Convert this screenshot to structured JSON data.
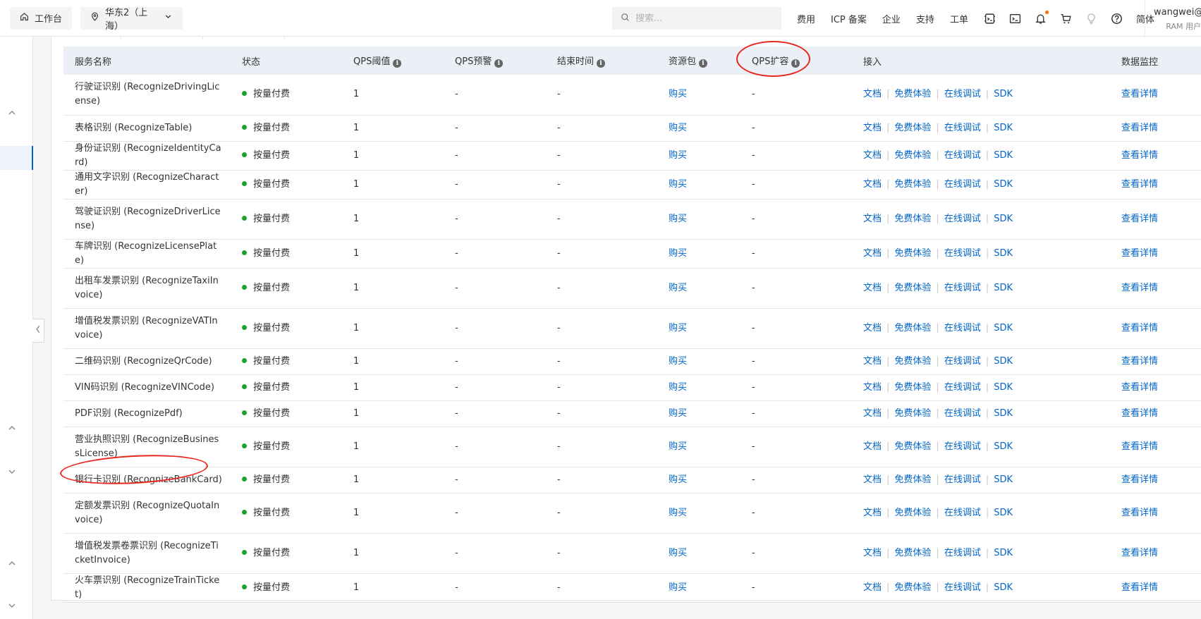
{
  "topbar": {
    "workbench_label": "工作台",
    "region_label": "华东2（上海）",
    "search_placeholder": "搜索...",
    "links": [
      "费用",
      "ICP 备案",
      "企业",
      "支持",
      "工单"
    ],
    "lang_label": "简体",
    "user_name": "wangwei@y...",
    "user_role": "RAM 用户"
  },
  "table": {
    "headers": {
      "service": "服务名称",
      "status": "状态",
      "qps_threshold": "QPS阈值",
      "qps_alert": "QPS预警",
      "end_time": "结束时间",
      "resource_pack": "资源包",
      "qps_scale": "QPS扩容",
      "access": "接入",
      "monitor": "数据监控"
    },
    "action_labels": {
      "buy": "购买",
      "docs": "文档",
      "trial": "免费体验",
      "debug": "在线调试",
      "sdk": "SDK",
      "details": "查看详情"
    },
    "rows": [
      {
        "service": "行驶证识别 (RecognizeDrivingLicense)",
        "status": "按量付费",
        "qps": "1",
        "alert": "-",
        "end": "-",
        "scale": "-"
      },
      {
        "service": "表格识别 (RecognizeTable)",
        "status": "按量付费",
        "qps": "1",
        "alert": "-",
        "end": "-",
        "scale": "-"
      },
      {
        "service": "身份证识别 (RecognizeIdentityCard)",
        "status": "按量付费",
        "qps": "1",
        "alert": "-",
        "end": "-",
        "scale": "-"
      },
      {
        "service": "通用文字识别 (RecognizeCharacter)",
        "status": "按量付费",
        "qps": "1",
        "alert": "-",
        "end": "-",
        "scale": "-"
      },
      {
        "service": "驾驶证识别 (RecognizeDriverLicense)",
        "status": "按量付费",
        "qps": "1",
        "alert": "-",
        "end": "-",
        "scale": "-"
      },
      {
        "service": "车牌识别 (RecognizeLicensePlate)",
        "status": "按量付费",
        "qps": "1",
        "alert": "-",
        "end": "-",
        "scale": "-"
      },
      {
        "service": "出租车发票识别 (RecognizeTaxiInvoice)",
        "status": "按量付费",
        "qps": "1",
        "alert": "-",
        "end": "-",
        "scale": "-"
      },
      {
        "service": "增值税发票识别 (RecognizeVATInvoice)",
        "status": "按量付费",
        "qps": "1",
        "alert": "-",
        "end": "-",
        "scale": "-"
      },
      {
        "service": "二维码识别 (RecognizeQrCode)",
        "status": "按量付费",
        "qps": "1",
        "alert": "-",
        "end": "-",
        "scale": "-"
      },
      {
        "service": "VIN码识别 (RecognizeVINCode)",
        "status": "按量付费",
        "qps": "1",
        "alert": "-",
        "end": "-",
        "scale": "-"
      },
      {
        "service": "PDF识别 (RecognizePdf)",
        "status": "按量付费",
        "qps": "1",
        "alert": "-",
        "end": "-",
        "scale": "-"
      },
      {
        "service": "营业执照识别 (RecognizeBusinessLicense)",
        "status": "按量付费",
        "qps": "1",
        "alert": "-",
        "end": "-",
        "scale": "-"
      },
      {
        "service": "银行卡识别 (RecognizeBankCard)",
        "status": "按量付费",
        "qps": "1",
        "alert": "-",
        "end": "-",
        "scale": "-"
      },
      {
        "service": "定额发票识别 (RecognizeQuotaInvoice)",
        "status": "按量付费",
        "qps": "1",
        "alert": "-",
        "end": "-",
        "scale": "-"
      },
      {
        "service": "增值税发票卷票识别 (RecognizeTicketInvoice)",
        "status": "按量付费",
        "qps": "1",
        "alert": "-",
        "end": "-",
        "scale": "-"
      },
      {
        "service": "火车票识别 (RecognizeTrainTicket)",
        "status": "按量付费",
        "qps": "1",
        "alert": "-",
        "end": "-",
        "scale": "-"
      }
    ]
  },
  "colors": {
    "link": "#0064c8",
    "status_dot": "#1fa12b",
    "annotation": "#e8261d",
    "header_bg": "#ebf0f7"
  }
}
